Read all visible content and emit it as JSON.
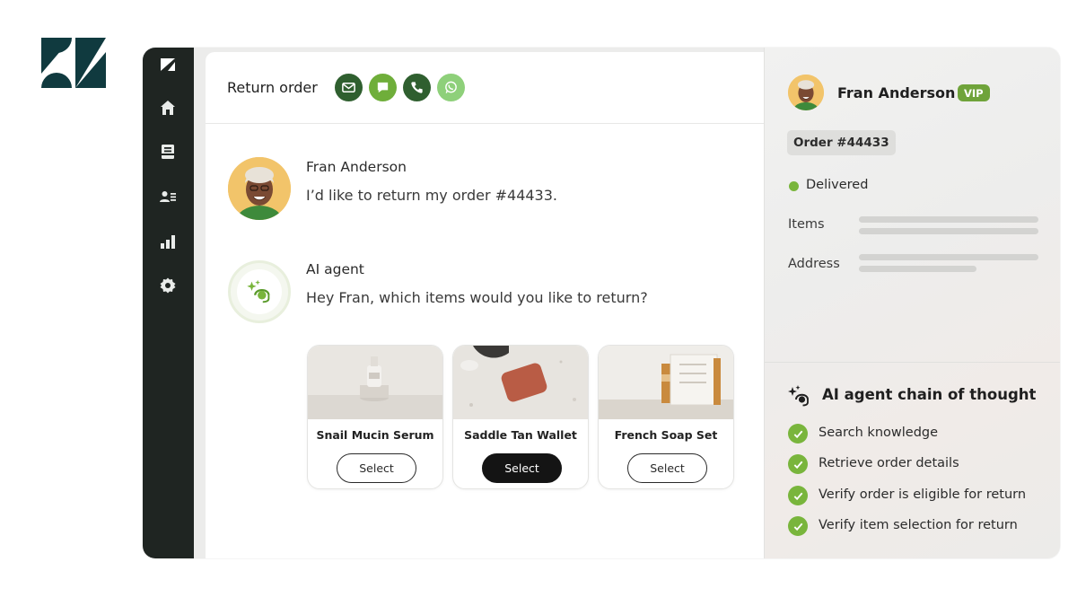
{
  "ticket": {
    "title": "Return order",
    "channels": [
      {
        "icon": "email-icon",
        "color": "#2f5f2f"
      },
      {
        "icon": "chat-bubble-icon",
        "color": "#6fae3a"
      },
      {
        "icon": "phone-icon",
        "color": "#2f5f2f"
      },
      {
        "icon": "whatsapp-icon",
        "color": "#8ed07a"
      }
    ]
  },
  "conversation": {
    "customer_name": "Fran Anderson",
    "customer_message": "I’d like to return my order #44433.",
    "agent_name": "AI agent",
    "agent_message": "Hey Fran, which items would you like to return?"
  },
  "products": [
    {
      "name": "Snail Mucin Serum",
      "button": "Select",
      "selected": false
    },
    {
      "name": "Saddle Tan Wallet",
      "button": "Select",
      "selected": true
    },
    {
      "name": "French Soap Set",
      "button": "Select",
      "selected": false
    }
  ],
  "customer_panel": {
    "name": "Fran Anderson",
    "badge": "VIP",
    "order": "Order #44433",
    "status": "Delivered",
    "fields": [
      "Items",
      "Address"
    ]
  },
  "chain_of_thought": {
    "title": "AI agent chain of thought",
    "steps": [
      "Search knowledge",
      "Retrieve order details",
      "Verify order is eligible for return",
      "Verify item selection for return"
    ]
  },
  "colors": {
    "sidebar": "#1f2522",
    "accent_green": "#79b53c",
    "vip_badge": "#6fa33a",
    "logo": "#103a3f"
  }
}
